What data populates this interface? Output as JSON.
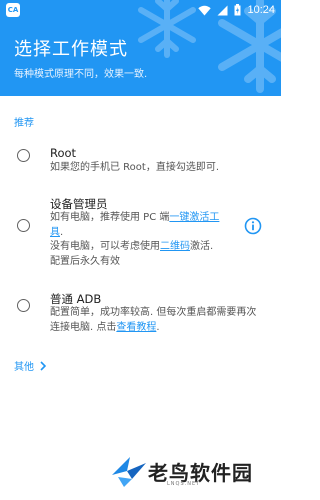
{
  "status_bar": {
    "app_icon": "CA",
    "time": "10:24",
    "icons": [
      "wifi-icon",
      "signal-icon",
      "battery-icon"
    ]
  },
  "header": {
    "title": "选择工作模式",
    "subtitle": "每种模式原理不同，效果一致."
  },
  "section": {
    "label": "推荐"
  },
  "options": [
    {
      "title": "Root",
      "desc": "如果您的手机已 Root，直接勾选即可.",
      "selected": false
    },
    {
      "title": "设备管理员",
      "desc_line1_pre": "如有电脑，推荐使用 PC 端",
      "desc_line1_link": "一键激活工",
      "desc_line2_link": "具",
      "desc_line2_post": ".",
      "desc_line3_pre": "没有电脑，可以考虑使用",
      "desc_line3_link": "二维码",
      "desc_line3_post": "激活.",
      "desc_line4": "配置后永久有效",
      "selected": false,
      "info_icon": "info-icon"
    },
    {
      "title": "普通 ADB",
      "desc_pre": "配置简单，成功率较高. 但每次重启都需要再次连接电脑. 点击",
      "desc_link": "查看教程",
      "desc_post": ".",
      "selected": false
    }
  ],
  "more": {
    "label": "其他",
    "icon": "chevron-right-icon"
  },
  "watermark": {
    "text": "老鸟软件园",
    "url": "LNQS.NET"
  },
  "colors": {
    "primary": "#2196f3",
    "text": "#212121",
    "secondary_text": "#555555",
    "radio": "#616161"
  }
}
